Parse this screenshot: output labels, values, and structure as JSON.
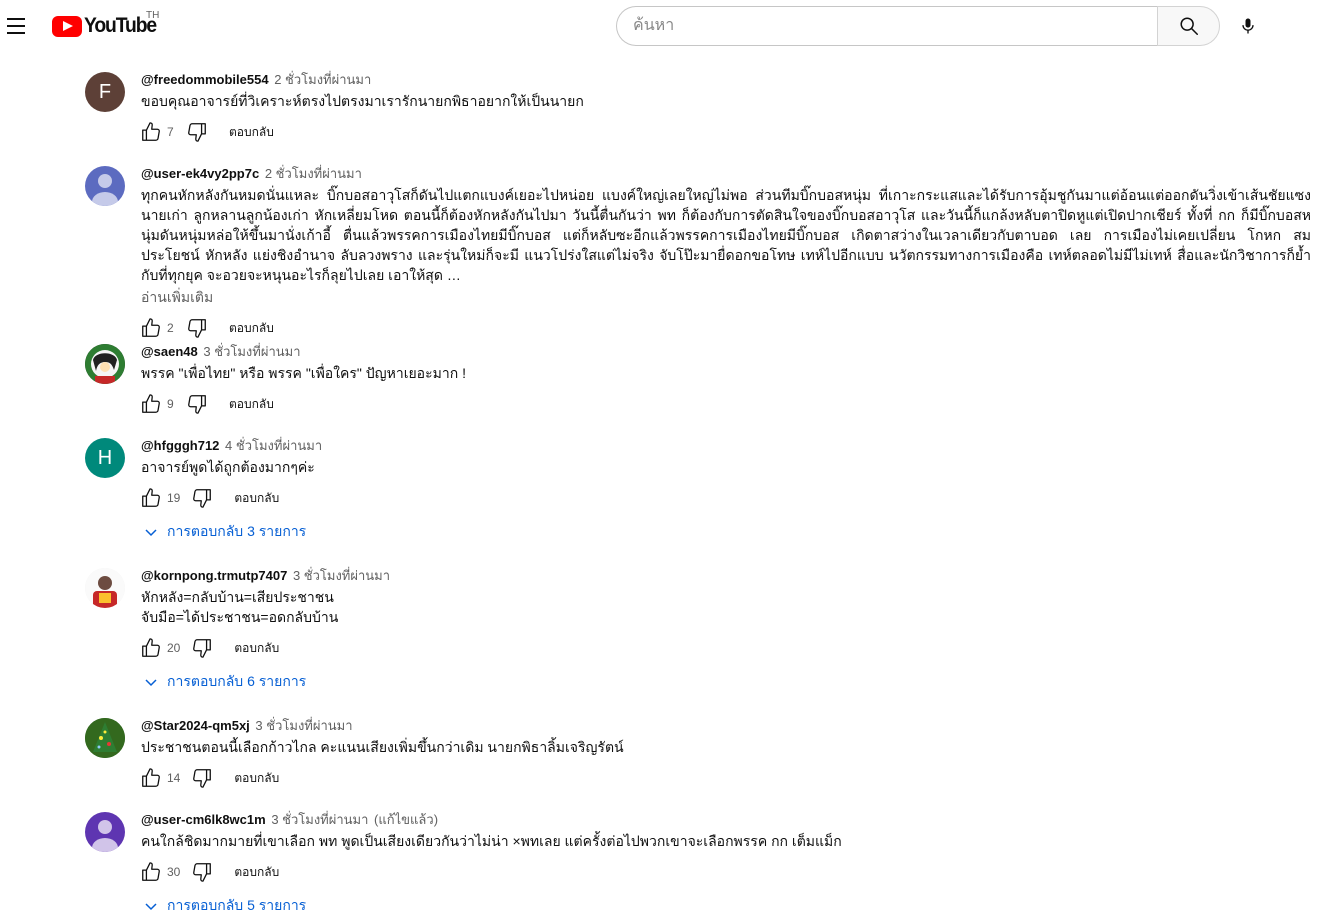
{
  "header": {
    "logo_text": "YouTube",
    "country_code": "TH",
    "search_placeholder": "ค้นหา"
  },
  "comments": [
    {
      "author": "@freedommobile554",
      "time": "2 ชั่วโมงที่ผ่านมา",
      "text": "ขอบคุณอาจารย์ที่วิเคราะห์ตรงไปตรงมาเรารักนายกพิธาอยากให้เป็นนายก",
      "likes": "7",
      "reply_label": "ตอบกลับ",
      "avatar_letter": "F",
      "avatar_color": "#5d4037"
    },
    {
      "author": "@user-ek4vy2pp7c",
      "time": "2 ชั่วโมงที่ผ่านมา",
      "text": "ทุกคนหักหลังกันหมดนั่นแหละ บิ๊กบอสอาวุโสก็ดันไปแตกแบงค์เยอะไปหน่อย แบงค์ใหญ่เลยใหญ่ไม่พอ ส่วนทีมบิ๊กบอสหนุ่ม ที่เกาะกระแสและได้รับการอุ้มชูกันมาแต่อ้อนแต่ออกดันวิ่งเข้าเส้นชัยแซง นายเก่า ลูกหลานลูกน้องเก่า หักเหลี่ยมโหด ตอนนี้ก็ต้องหักหลังกันไปมา วันนี้ตื่นกันว่า พท ก็ต้องกับการตัดสินใจของบิ๊กบอสอาวุโส  และวันนี้ก็แกล้งหลับตาปิดหูแต่เปิดปากเชียร์ ทั้งที่ กก ก็มีบิ๊กบอสหนุ่มดันหนุ่มหล่อให้ขึ้นมานั่งเก้าอี้  ตื่นแล้วพรรคการเมืองไทยมีบิ๊กบอส  แต่ก็หลับซะอีกแล้วพรรคการเมืองไทยมีบิ๊กบอส  เกิดตาสว่างในเวลาเดียวกับตาบอด เลย การเมืองไม่เคยเปลี่ยน โกหก สมประโยชน์ หักหลัง แย่งชิงอำนาจ ลับลวงพราง และรุ่นใหม่ก็จะมี แนวโปร่งใสแต่ไม่จริง จับโป๊ะมายื่ดอกขอโทษ เทห์ไปอีกแบบ นวัตกรรมทางการเมืองคือ เทห์ตลอดไม่มีไม่เทห์ สื่อและนักวิชาการก็ย้ำกับที่ทุกยุค จะอวยจะหนุนอะไรก็ลุยไปเลย เอาให้สุด …",
      "read_more": "อ่านเพิ่มเติม",
      "likes": "2",
      "reply_label": "ตอบกลับ",
      "avatar_letter": "",
      "avatar_color": "#5c6bc0"
    },
    {
      "author": "@saen48",
      "time": "3 ชั่วโมงที่ผ่านมา",
      "text": "พรรค \"เพื่อไทย\"  หรือ  พรรค \"เพื่อใคร\"  ปัญหาเยอะมาก !",
      "likes": "9",
      "reply_label": "ตอบกลับ",
      "avatar_letter": "",
      "avatar_color": "#2e7d32"
    },
    {
      "author": "@hfgggh712",
      "time": "4 ชั่วโมงที่ผ่านมา",
      "text": "อาจารย์พูดได้ถูกต้องมากๆค่ะ",
      "likes": "19",
      "reply_label": "ตอบกลับ",
      "replies_label": "การตอบกลับ 3 รายการ",
      "avatar_letter": "H",
      "avatar_color": "#00897b"
    },
    {
      "author": "@kornpong.trmutp7407",
      "time": "3 ชั่วโมงที่ผ่านมา",
      "text": "หักหลัง=กลับบ้าน=เสียประชาชน\nจับมือ=ได้ประชาชน=อดกลับบ้าน",
      "likes": "20",
      "reply_label": "ตอบกลับ",
      "replies_label": "การตอบกลับ 6 รายการ",
      "avatar_letter": "",
      "avatar_color": "#c62828"
    },
    {
      "author": "@Star2024-qm5xj",
      "time": "3 ชั่วโมงที่ผ่านมา",
      "text": "ประชาชนตอนนี้เลือกก้าวไกล คะแนนเสียงเพิ่มขึ้นกว่าเดิม นายกพิธาลิ้มเจริญรัตน์",
      "likes": "14",
      "reply_label": "ตอบกลับ",
      "avatar_letter": "",
      "avatar_color": "#1b5e20"
    },
    {
      "author": "@user-cm6lk8wc1m",
      "time": "3 ชั่วโมงที่ผ่านมา",
      "edited": "(แก้ไขแล้ว)",
      "text": "คนใกล้ชิดมากมายที่เขาเลือก พท พูดเป็นเสียงเดียวกันว่าไม่น่า ×พทเลย แต่ครั้งต่อไปพวกเขาจะเลือกพรรค กก เต็มแม็ก",
      "likes": "30",
      "reply_label": "ตอบกลับ",
      "replies_label": "การตอบกลับ 5 รายการ",
      "avatar_letter": "",
      "avatar_color": "#5e35b1"
    }
  ]
}
